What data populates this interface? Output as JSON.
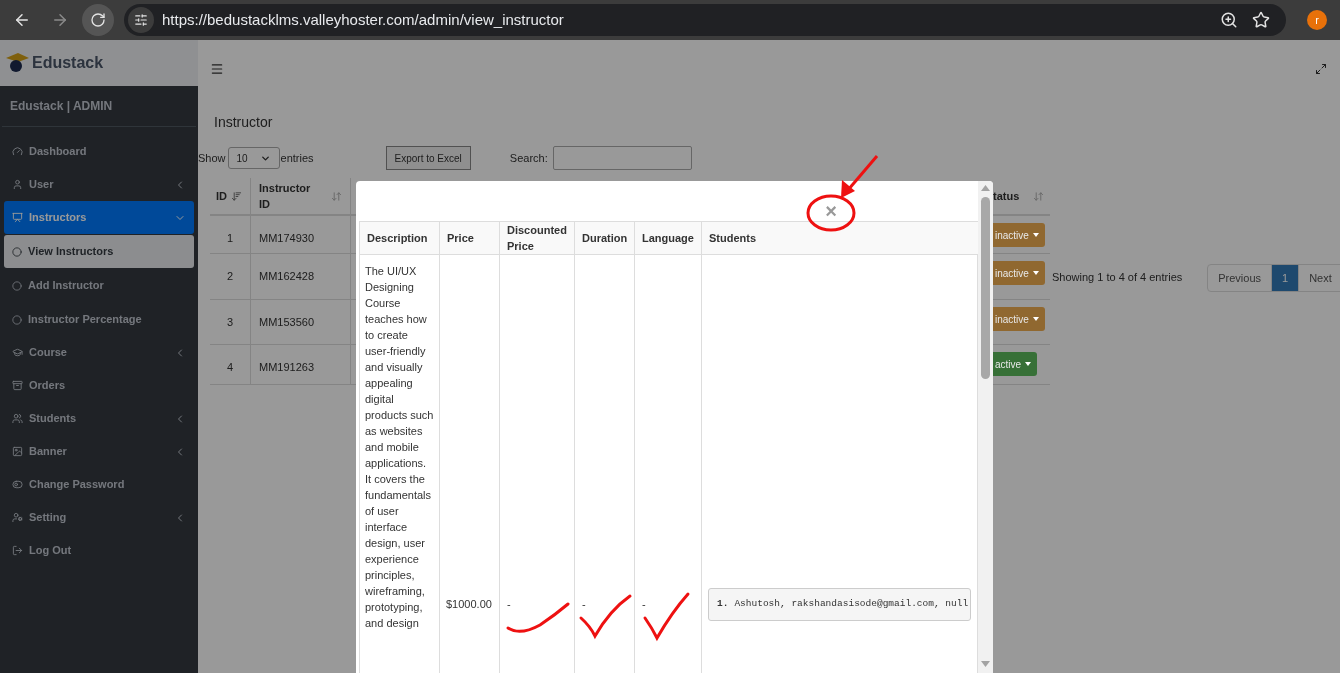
{
  "browser": {
    "url": "https://bedustacklms.valleyhoster.com/admin/view_instructor",
    "profile_initial": "r"
  },
  "sidebar": {
    "brand": "Edustack",
    "header": "Edustack | ADMIN",
    "items": [
      {
        "label": "Dashboard",
        "kind": "link",
        "selected": false
      },
      {
        "label": "User",
        "kind": "group",
        "selected": false,
        "expanded": false
      },
      {
        "label": "Instructors",
        "kind": "group",
        "selected": true,
        "expanded": true,
        "children": [
          {
            "label": "View Instructors",
            "selected": true
          },
          {
            "label": "Add Instructor",
            "selected": false
          },
          {
            "label": "Instructor Percentage",
            "selected": false
          }
        ]
      },
      {
        "label": "Course",
        "kind": "group",
        "selected": false,
        "expanded": false
      },
      {
        "label": "Orders",
        "kind": "link",
        "selected": false
      },
      {
        "label": "Students",
        "kind": "group",
        "selected": false,
        "expanded": false
      },
      {
        "label": "Banner",
        "kind": "group",
        "selected": false,
        "expanded": false
      },
      {
        "label": "Change Password",
        "kind": "link",
        "selected": false
      },
      {
        "label": "Setting",
        "kind": "group",
        "selected": false,
        "expanded": false
      },
      {
        "label": "Log Out",
        "kind": "link",
        "selected": false
      }
    ]
  },
  "page": {
    "title": "Instructor",
    "show_label": "Show",
    "page_length": "10",
    "entries_label": "entries",
    "export_button": "Export to Excel",
    "search_label": "Search:"
  },
  "table": {
    "columns": [
      "ID",
      "Instructor ID"
    ],
    "status_column": "tatus",
    "rows": [
      {
        "id": "1",
        "instructor_id": "MM174930",
        "status": "inactive",
        "color": "#906830"
      },
      {
        "id": "2",
        "instructor_id": "MM162428",
        "status": "inactive",
        "color": "#906830"
      },
      {
        "id": "3",
        "instructor_id": "MM153560",
        "status": "inactive",
        "color": "#906830"
      },
      {
        "id": "4",
        "instructor_id": "MM191263",
        "status": "active",
        "color": "#377037"
      }
    ]
  },
  "info": "Showing 1 to 4 of 4 entries",
  "pagination": [
    {
      "label": "Previous",
      "selected": false
    },
    {
      "label": "1",
      "selected": true
    },
    {
      "label": "Next",
      "selected": false
    }
  ],
  "modal": {
    "close": "×",
    "columns": [
      "Description",
      "Price",
      "Discounted Price",
      "Duration",
      "Language",
      "Students"
    ],
    "rows": [
      {
        "description": "The UI/UX Designing Course teaches how to create user-friendly and visually appealing digital products such as websites and mobile applications. It covers the fundamentals of user interface design, user experience principles, wireframing, prototyping, and design",
        "price": "$1000.00",
        "discounted_price": "-",
        "duration": "-",
        "language": "-",
        "students": [
          {
            "number": "1.",
            "text": "Ashutosh, rakshandasisode@gmail.com, null"
          }
        ]
      }
    ]
  }
}
